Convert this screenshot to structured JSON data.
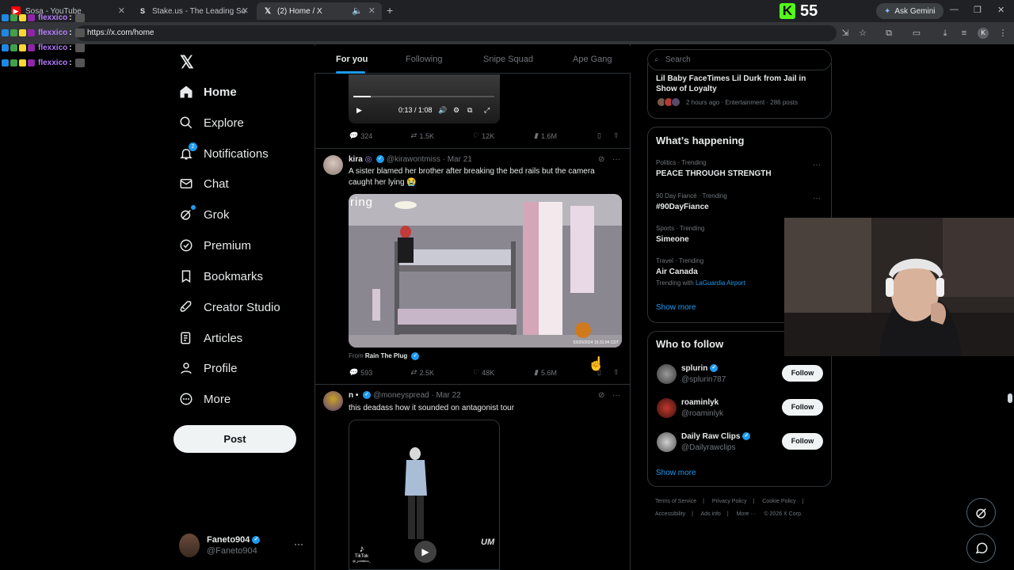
{
  "browser": {
    "tabs": [
      {
        "title": "Sosa - YouTube"
      },
      {
        "title": "Stake.us - The Leading Social C"
      },
      {
        "title": "(2) Home / X"
      }
    ],
    "new_tab": "+",
    "kick_counter": "55",
    "kick_logo": "K",
    "ask_gemini": "Ask Gemini",
    "url": "https://x.com/home",
    "profile_initial": "K"
  },
  "chat_overlay": {
    "lines": [
      {
        "user": "flexxico",
        "colon": ":"
      },
      {
        "user": "flexxico",
        "colon": ":"
      },
      {
        "user": "flexxico",
        "colon": ":"
      },
      {
        "user": "flexxico",
        "colon": ":"
      }
    ]
  },
  "sidebar": {
    "items": [
      {
        "label": "Home",
        "icon": "home-icon"
      },
      {
        "label": "Explore",
        "icon": "search-icon"
      },
      {
        "label": "Notifications",
        "icon": "bell-icon",
        "badge": "2"
      },
      {
        "label": "Chat",
        "icon": "mail-icon"
      },
      {
        "label": "Grok",
        "icon": "grok-icon"
      },
      {
        "label": "Premium",
        "icon": "premium-icon"
      },
      {
        "label": "Bookmarks",
        "icon": "bookmark-icon"
      },
      {
        "label": "Creator Studio",
        "icon": "rocket-icon"
      },
      {
        "label": "Articles",
        "icon": "articles-icon"
      },
      {
        "label": "Profile",
        "icon": "person-icon"
      },
      {
        "label": "More",
        "icon": "more-circle-icon"
      }
    ],
    "post_label": "Post",
    "account": {
      "name": "Faneto904",
      "handle": "@Faneto904"
    }
  },
  "feed": {
    "tabs": [
      "For you",
      "Following",
      "Snipe Squad",
      "Ape Gang"
    ],
    "tweet1": {
      "video_time": "0:13 / 1:08",
      "replies": "324",
      "reposts": "1.5K",
      "likes": "12K",
      "views": "1.6M"
    },
    "tweet2": {
      "name": "kira",
      "handle": "@kirawontmiss",
      "date": "· Mar 21",
      "text": "A sister blamed her brother after breaking the bed rails but the camera caught her lying 😭",
      "media_brand": "ring",
      "media_timestamp": "03/20/2024 15:31:04 CDT",
      "from_prefix": "From",
      "from_name": "Rain The Plug",
      "replies": "593",
      "reposts": "2.5K",
      "likes": "48K",
      "views": "5.6M"
    },
    "tweet3": {
      "name": "n •",
      "handle": "@moneyspread",
      "date": "· Mar 22",
      "text": "this deadass how it sounded on antagonist tour",
      "tiktok_label": "TikTok",
      "tiktok_handle": "@_prettifun_",
      "watermark": "UM"
    }
  },
  "right": {
    "search_placeholder": "Search",
    "news": {
      "title": "Lil Baby FaceTimes Lil Durk from Jail in Show of Loyalty",
      "meta": "2 hours ago · Entertainment · 286 posts"
    },
    "happening_title": "What’s happening",
    "trends": [
      {
        "category": "Politics · Trending",
        "name": "PEACE THROUGH STRENGTH"
      },
      {
        "category": "90 Day Fiancé · Trending",
        "name": "#90DayFiance"
      },
      {
        "category": "Sports · Trending",
        "name": "Simeone"
      },
      {
        "category": "Travel · Trending",
        "name": "Air Canada",
        "with_prefix": "Trending with",
        "with_link": "LaGuardia Airport"
      }
    ],
    "show_more": "Show more",
    "wtf_title": "Who to follow",
    "who_to_follow": [
      {
        "name": "splurin",
        "handle": "@splurin787",
        "button": "Follow"
      },
      {
        "name": "roaminlyk",
        "handle": "@roaminlyk",
        "button": "Follow"
      },
      {
        "name": "Daily Raw Clips",
        "handle": "@Dailyrawclips",
        "button": "Follow"
      }
    ],
    "footer": [
      "Terms of Service",
      "|",
      "Privacy Policy",
      "|",
      "Cookie Policy",
      "|",
      "Accessibility",
      "|",
      "Ads info",
      "|",
      "More ···",
      "© 2026 X Corp."
    ]
  },
  "colors": {
    "accent": "#1d9bf0",
    "bg": "#000000",
    "border": "#2f3336",
    "muted": "#71767b"
  }
}
